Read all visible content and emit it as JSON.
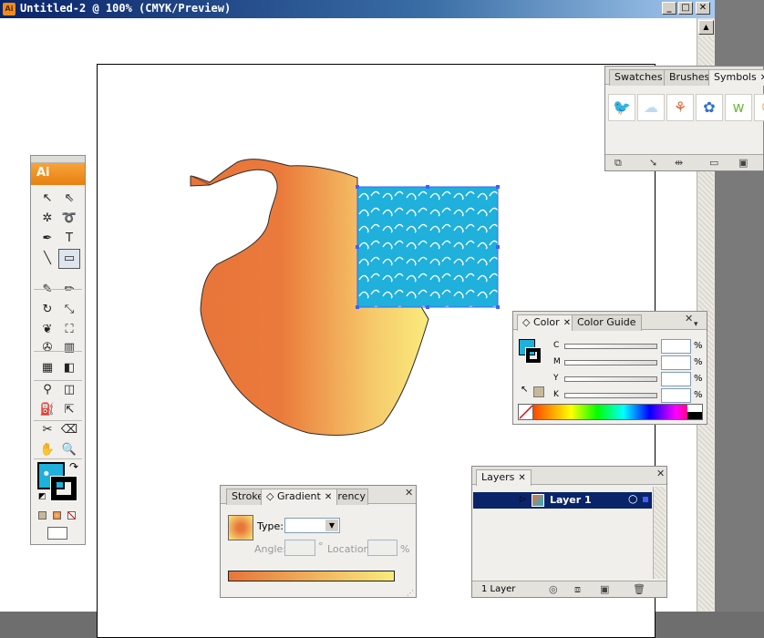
{
  "window": {
    "title": "Untitled-2 @ 100% (CMYK/Preview)",
    "app_icon_text": "Ai",
    "minimize_label": "_",
    "maximize_label": "□",
    "close_label": "✕"
  },
  "tools_panel": {
    "logo_text": "Ai",
    "tools": [
      {
        "name": "selection-tool",
        "glyph": "↖"
      },
      {
        "name": "direct-selection-tool",
        "glyph": "⇖"
      },
      {
        "name": "magic-wand-tool",
        "glyph": "✲"
      },
      {
        "name": "lasso-tool",
        "glyph": "➰"
      },
      {
        "name": "pen-tool",
        "glyph": "✒"
      },
      {
        "name": "type-tool",
        "glyph": "T"
      },
      {
        "name": "line-segment-tool",
        "glyph": "╲"
      },
      {
        "name": "rectangle-tool",
        "glyph": "▭"
      },
      {
        "name": "paintbrush-tool",
        "glyph": "✎"
      },
      {
        "name": "pencil-tool",
        "glyph": "✏"
      },
      {
        "name": "rotate-tool",
        "glyph": "↻"
      },
      {
        "name": "scale-tool",
        "glyph": "⤡"
      },
      {
        "name": "warp-tool",
        "glyph": "❦"
      },
      {
        "name": "free-transform-tool",
        "glyph": "⛶"
      },
      {
        "name": "symbol-sprayer-tool",
        "glyph": "✇"
      },
      {
        "name": "column-graph-tool",
        "glyph": "▥"
      },
      {
        "name": "mesh-tool",
        "glyph": "▦"
      },
      {
        "name": "gradient-tool",
        "glyph": "◧"
      },
      {
        "name": "eyedropper-tool",
        "glyph": "⚲"
      },
      {
        "name": "blend-tool",
        "glyph": "◫"
      },
      {
        "name": "live-paint-bucket-tool",
        "glyph": "⛽"
      },
      {
        "name": "live-paint-selection-tool",
        "glyph": "⇱"
      },
      {
        "name": "slice-tool",
        "glyph": "✂"
      },
      {
        "name": "eraser-tool",
        "glyph": "⌫"
      },
      {
        "name": "hand-tool",
        "glyph": "✋"
      },
      {
        "name": "zoom-tool",
        "glyph": "🔍"
      }
    ]
  },
  "symbols_panel": {
    "tabs": [
      "Swatches",
      "Brushes",
      "Symbols"
    ],
    "close_label": "✕",
    "symbols": [
      {
        "name": "bird-symbol",
        "glyph": "🐦"
      },
      {
        "name": "cloud-symbol",
        "glyph": "☁"
      },
      {
        "name": "flower-symbol",
        "glyph": "⚘"
      },
      {
        "name": "blue-flower-symbol",
        "glyph": "✿"
      },
      {
        "name": "grass-symbol",
        "glyph": "ᴡ"
      },
      {
        "name": "puff-symbol",
        "glyph": "❂"
      }
    ]
  },
  "color_panel": {
    "tabs": [
      "Color",
      "Color Guide"
    ],
    "close_label": "✕",
    "flyout_label": "▾",
    "channels": [
      {
        "label": "C",
        "value": "",
        "unit": "%"
      },
      {
        "label": "M",
        "value": "",
        "unit": "%"
      },
      {
        "label": "Y",
        "value": "",
        "unit": "%"
      },
      {
        "label": "K",
        "value": "",
        "unit": "%"
      }
    ]
  },
  "gradient_panel": {
    "tabs": [
      "Stroke",
      "Gradient",
      "Transparency"
    ],
    "close_label": "✕",
    "type_label": "Type:",
    "type_value": "",
    "angle_label": "Angle:",
    "angle_unit": "°",
    "location_label": "Location:",
    "location_unit": "%",
    "stops": [
      "#e8753a",
      "#f9eb7c"
    ]
  },
  "layers_panel": {
    "tab": "Layers",
    "close_label": "✕",
    "layers": [
      {
        "name": "Layer 1"
      }
    ],
    "count_label": "1 Layer"
  },
  "colors": {
    "pattern_fill": "#1fb0dc",
    "gradient_start": "#e8753a",
    "gradient_end": "#f9eb7c",
    "selection": "#4060ff"
  }
}
